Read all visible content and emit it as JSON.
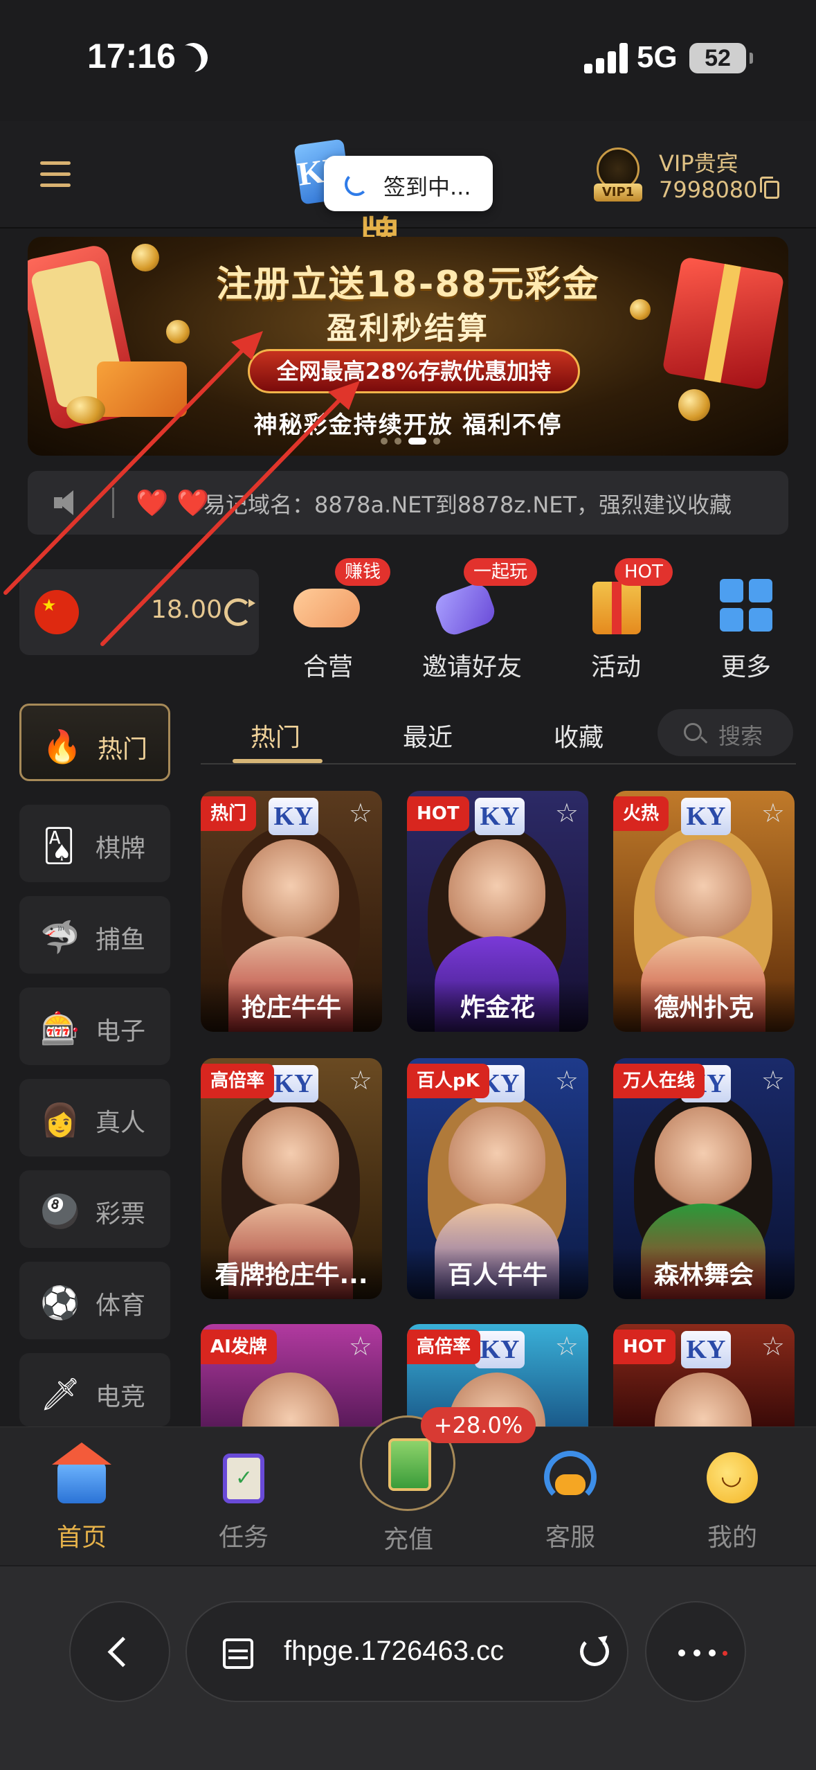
{
  "status": {
    "time": "17:16",
    "network": "5G",
    "battery": "52"
  },
  "header": {
    "logo_badge": "KY",
    "logo_text": "开元棋牌",
    "toast": "签到中...",
    "vip_title": "VIP贵宾",
    "vip_level": "VIP1",
    "account_id": "7998080"
  },
  "banner": {
    "title": "注册立送18-88元彩金",
    "subtitle": "盈利秒结算",
    "pill": "全网最高28%存款优惠加持",
    "footer": "神秘彩金持续开放  福利不停"
  },
  "notice": {
    "hearts": "❤️ ❤️",
    "text": "易记域名：8878a.NET到8878z.NET，强烈建议收藏"
  },
  "wallet": {
    "balance": "18.00"
  },
  "quick_actions": [
    {
      "label": "合营",
      "badge": "赚钱"
    },
    {
      "label": "邀请好友",
      "badge": "一起玩"
    },
    {
      "label": "活动",
      "badge": "HOT"
    },
    {
      "label": "更多",
      "badge": ""
    }
  ],
  "sidebar": {
    "items": [
      {
        "label": "热门",
        "icon": "🔥"
      },
      {
        "label": "棋牌",
        "icon": "🂡"
      },
      {
        "label": "捕鱼",
        "icon": "🦈"
      },
      {
        "label": "电子",
        "icon": "🎰"
      },
      {
        "label": "真人",
        "icon": "👩"
      },
      {
        "label": "彩票",
        "icon": "🎱"
      },
      {
        "label": "体育",
        "icon": "⚽"
      },
      {
        "label": "电竞",
        "icon": "🗡"
      }
    ]
  },
  "tabs": {
    "items": [
      "热门",
      "最近",
      "收藏"
    ],
    "search_placeholder": "搜索"
  },
  "games": [
    {
      "name": "抢庄牛牛",
      "tag": "热门"
    },
    {
      "name": "炸金花",
      "tag": "HOT"
    },
    {
      "name": "德州扑克",
      "tag": "火热"
    },
    {
      "name": "看牌抢庄牛...",
      "tag": "高倍率"
    },
    {
      "name": "百人牛牛",
      "tag": "百人pK"
    },
    {
      "name": "森林舞会",
      "tag": "万人在线"
    },
    {
      "name": "",
      "tag": "AI发牌"
    },
    {
      "name": "",
      "tag": "高倍率"
    },
    {
      "name": "",
      "tag": "HOT"
    }
  ],
  "bottom_nav": {
    "items": [
      "首页",
      "任务",
      "充值",
      "客服",
      "我的"
    ],
    "recharge_bonus": "+28.0%"
  },
  "browser": {
    "url": "fhpge.1726463.cc"
  },
  "colors": {
    "accent_gold": "#e6b24a",
    "badge_red": "#e2322d",
    "background": "#1c1c1e"
  }
}
